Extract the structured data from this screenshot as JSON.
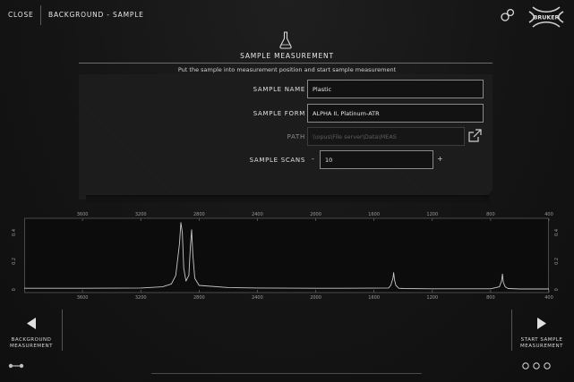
{
  "topbar": {
    "close_label": "CLOSE",
    "breadcrumb": "BACKGROUND - SAMPLE",
    "logo_text": "BRUKER"
  },
  "panel": {
    "title": "SAMPLE MEASUREMENT",
    "instruction": "Put the sample into measurement position and start sample measurement"
  },
  "form": {
    "sample_name": {
      "label": "SAMPLE NAME",
      "value": "Plastic"
    },
    "sample_form": {
      "label": "SAMPLE FORM",
      "value": "ALPHA II, Platinum-ATR"
    },
    "path": {
      "label": "PATH",
      "value": "\\\\opus\\File server\\Data\\MEAS"
    },
    "sample_scans": {
      "label": "SAMPLE SCANS",
      "value": "10",
      "minus": "-",
      "plus": "+"
    }
  },
  "chart_data": {
    "type": "line",
    "x_ticks": [
      "3600",
      "3200",
      "2800",
      "2400",
      "2000",
      "1600",
      "1200",
      "800",
      "400"
    ],
    "y_ticks": [
      "0",
      "0.2",
      "0.4"
    ],
    "xlim": [
      4000,
      400
    ],
    "ylim": [
      -0.02,
      0.5
    ],
    "grid": false,
    "series": [
      {
        "color": "#c8c8c8",
        "x": [
          4000,
          3600,
          3200,
          3050,
          2990,
          2960,
          2935,
          2925,
          2915,
          2905,
          2890,
          2870,
          2860,
          2851,
          2843,
          2830,
          2800,
          2600,
          2400,
          2000,
          1800,
          1500,
          1485,
          1470,
          1465,
          1460,
          1450,
          1430,
          1400,
          1200,
          1000,
          800,
          740,
          725,
          719,
          713,
          700,
          680,
          600,
          400
        ],
        "y": [
          0.01,
          0.01,
          0.012,
          0.02,
          0.04,
          0.1,
          0.32,
          0.47,
          0.4,
          0.15,
          0.06,
          0.1,
          0.3,
          0.42,
          0.25,
          0.08,
          0.03,
          0.015,
          0.012,
          0.01,
          0.01,
          0.012,
          0.03,
          0.08,
          0.12,
          0.07,
          0.03,
          0.01,
          0.008,
          0.006,
          0.006,
          0.006,
          0.02,
          0.06,
          0.11,
          0.05,
          0.02,
          0.008,
          0.005,
          0.005
        ]
      }
    ]
  },
  "nav": {
    "left_line1": "BACKGROUND",
    "left_line2": "MEASUREMENT",
    "right_line1": "START SAMPLE",
    "right_line2": "MEASUREMENT"
  },
  "colors": {
    "background": "#141414",
    "text": "#e6e6e6",
    "field_border": "#8a8a8a",
    "trace": "#c8c8c8"
  }
}
